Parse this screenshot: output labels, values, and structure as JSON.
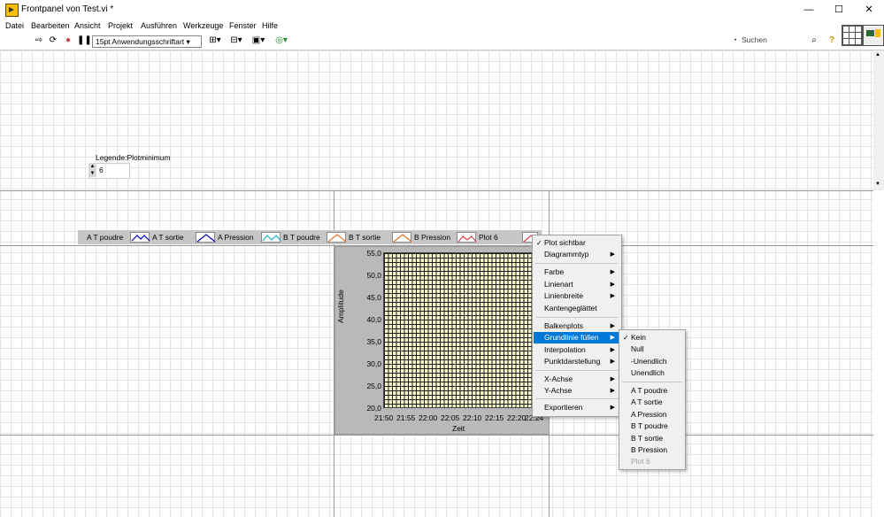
{
  "window": {
    "title": "Frontpanel von Test.vi *",
    "minimize": "—",
    "maximize": "☐",
    "close": "✕"
  },
  "menu": [
    "Datei",
    "Bearbeiten",
    "Ansicht",
    "Projekt",
    "Ausführen",
    "Werkzeuge",
    "Fenster",
    "Hilfe"
  ],
  "toolbar": {
    "font": "15pt Anwendungsschriftart",
    "search_placeholder": "Suchen"
  },
  "control": {
    "label": "Legende:Plotminimum",
    "value": "6"
  },
  "legend": [
    "A T poudre",
    "A T sortie",
    "A Pression",
    "B T poudre",
    "B T sortie",
    "B Pression",
    "Plot 6"
  ],
  "chart": {
    "ylabel": "Amplitude",
    "xlabel": "Zeit",
    "yticks": [
      "55,0",
      "50,0",
      "45,0",
      "40,0",
      "35,0",
      "30,0",
      "25,0",
      "20,0"
    ],
    "xticks": [
      "21:50",
      "21:55",
      "22:00",
      "22:05",
      "22:10",
      "22:15",
      "22:20",
      "22:24"
    ],
    "plot_bg": "#f5f5c8"
  },
  "context_menu": {
    "items": [
      {
        "label": "Plot sichtbar",
        "checked": true
      },
      {
        "label": "Diagrammtyp",
        "submenu": true
      },
      {
        "label": "Farbe",
        "submenu": true
      },
      {
        "label": "Linienart",
        "submenu": true
      },
      {
        "label": "Linienbreite",
        "submenu": true
      },
      {
        "label": "Kantengeglättet"
      },
      {
        "label": "Balkenplots",
        "submenu": true
      },
      {
        "label": "Grundlinie füllen",
        "submenu": true,
        "selected": true
      },
      {
        "label": "Interpolation",
        "submenu": true
      },
      {
        "label": "Punktdarstellung",
        "submenu": true
      },
      {
        "label": "X-Achse",
        "submenu": true
      },
      {
        "label": "Y-Achse",
        "submenu": true
      },
      {
        "label": "Exportieren",
        "submenu": true
      }
    ]
  },
  "submenu": {
    "items": [
      {
        "label": "Kein",
        "checked": true
      },
      {
        "label": "Null"
      },
      {
        "label": "-Unendlich"
      },
      {
        "label": "Unendlich"
      },
      {
        "label": "A T poudre"
      },
      {
        "label": "A T sortie"
      },
      {
        "label": "A Pression"
      },
      {
        "label": "B T poudre"
      },
      {
        "label": "B T sortie"
      },
      {
        "label": "B Pression"
      },
      {
        "label": "Plot 6",
        "disabled": true
      }
    ]
  },
  "colors": {
    "selection": "#0078d7",
    "legend_a": "#0000b0",
    "legend_b_poudre": "#20b0c0",
    "legend_b": "#e07020",
    "legend_plot6": "#e04050"
  }
}
